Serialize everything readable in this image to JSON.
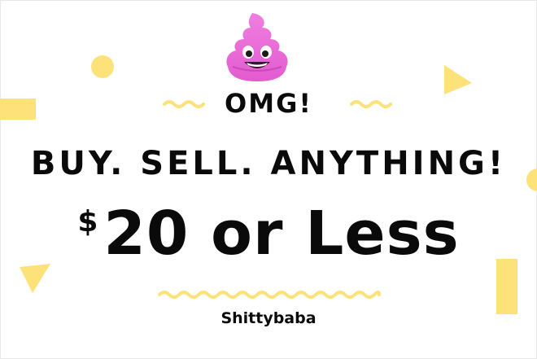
{
  "headline": "OMG!",
  "tagline": "BUY. SELL. ANYTHING!",
  "price": {
    "currency": "$",
    "text": "20 or Less"
  },
  "brand": "Shittybaba",
  "colors": {
    "background": "#ffffff",
    "text": "#0a0a0a",
    "accent_yellow": "#fde27a",
    "emoji_pink": "#ef6ad8"
  },
  "icons": {
    "mascot": "pink-poop-emoji-icon"
  }
}
